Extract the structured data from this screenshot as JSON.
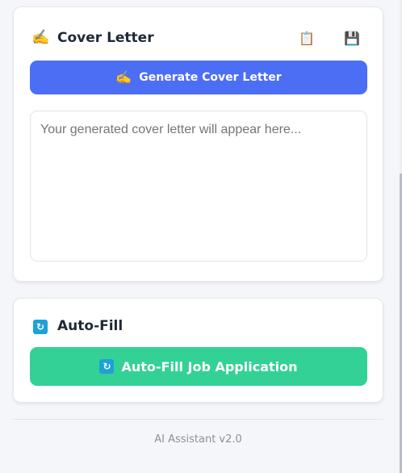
{
  "cover_letter": {
    "title": "Cover Letter",
    "title_icon": "writing-hand-icon",
    "title_emoji": "✍️",
    "copy_icon": "clipboard-icon",
    "copy_emoji": "📋",
    "save_icon": "floppy-disk-icon",
    "save_emoji": "💾",
    "generate_button": {
      "label": "Generate Cover Letter",
      "icon": "writing-hand-icon",
      "emoji": "✍️",
      "color": "#4c6ef5"
    },
    "output": {
      "value": "",
      "placeholder": "Your generated cover letter will appear here..."
    }
  },
  "auto_fill": {
    "title": "Auto-Fill",
    "title_icon": "refresh-icon",
    "title_emoji": "🔄",
    "button": {
      "label": "Auto-Fill Job Application",
      "icon": "refresh-icon",
      "emoji": "🔄",
      "color": "#33d196"
    }
  },
  "footer": {
    "version_text": "AI Assistant v2.0"
  }
}
